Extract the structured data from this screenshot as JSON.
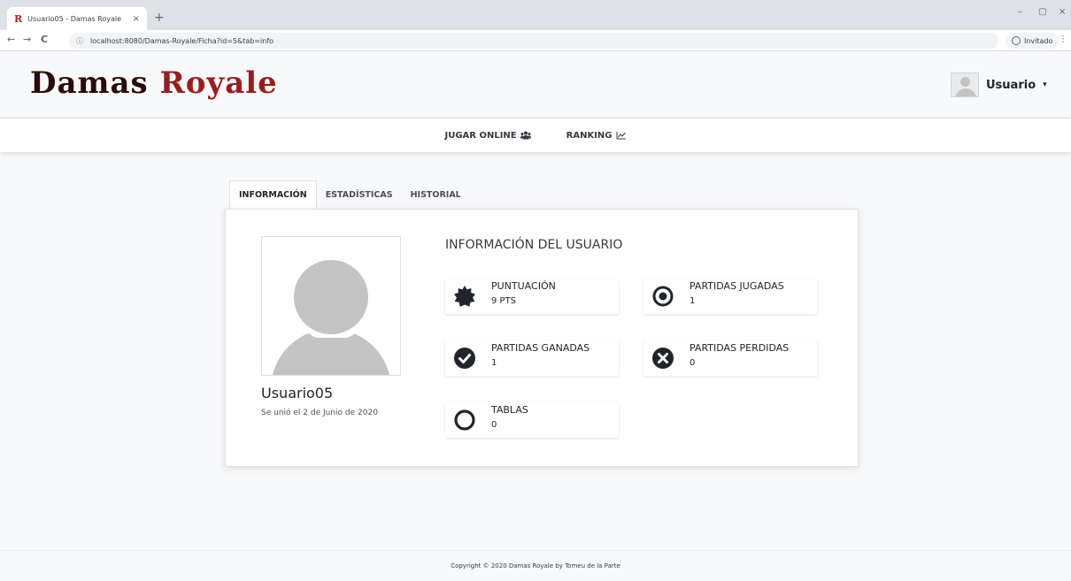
{
  "browser": {
    "tab_title": "Usuario05 - Damas Royale",
    "tab_favicon": "R",
    "tab_close": "×",
    "new_tab": "+",
    "url": "localhost:8080/Damas-Royale/Ficha?id=5&tab=info",
    "profile_label": "Invitado",
    "back": "←",
    "forward": "→",
    "reload": "C",
    "info_icon": "ⓘ",
    "minimize": "–",
    "restore": "▢",
    "close": "×",
    "menu": "⋮"
  },
  "header": {
    "logo_part1": "Damas ",
    "logo_part2": "Royale",
    "user_label": "Usuario",
    "caret": "▾"
  },
  "nav": {
    "items": [
      {
        "label": "JUGAR ONLINE",
        "icon": "users-icon"
      },
      {
        "label": "RANKING",
        "icon": "chart-line-icon"
      }
    ]
  },
  "tabs": [
    {
      "label": "INFORMACIÓN",
      "active": true
    },
    {
      "label": "ESTADÍSTICAS",
      "active": false
    },
    {
      "label": "HISTORIAL",
      "active": false
    }
  ],
  "profile": {
    "username": "Usuario05",
    "joined": "Se unió el 2 de Junio de 2020"
  },
  "info": {
    "title": "INFORMACIÓN DEL USUARIO",
    "stats": [
      {
        "label": "PUNTUACIÓN",
        "value": "9 PTS",
        "icon": "certificate-icon"
      },
      {
        "label": "PARTIDAS JUGADAS",
        "value": "1",
        "icon": "dot-circle-icon"
      },
      {
        "label": "PARTIDAS GANADAS",
        "value": "1",
        "icon": "check-circle-icon"
      },
      {
        "label": "PARTIDAS PERDIDAS",
        "value": "0",
        "icon": "times-circle-icon"
      },
      {
        "label": "TABLAS",
        "value": "0",
        "icon": "circle-icon"
      }
    ]
  },
  "footer": {
    "text": "Copyright © 2020 Damas Royale by Tomeu de la Parte"
  }
}
